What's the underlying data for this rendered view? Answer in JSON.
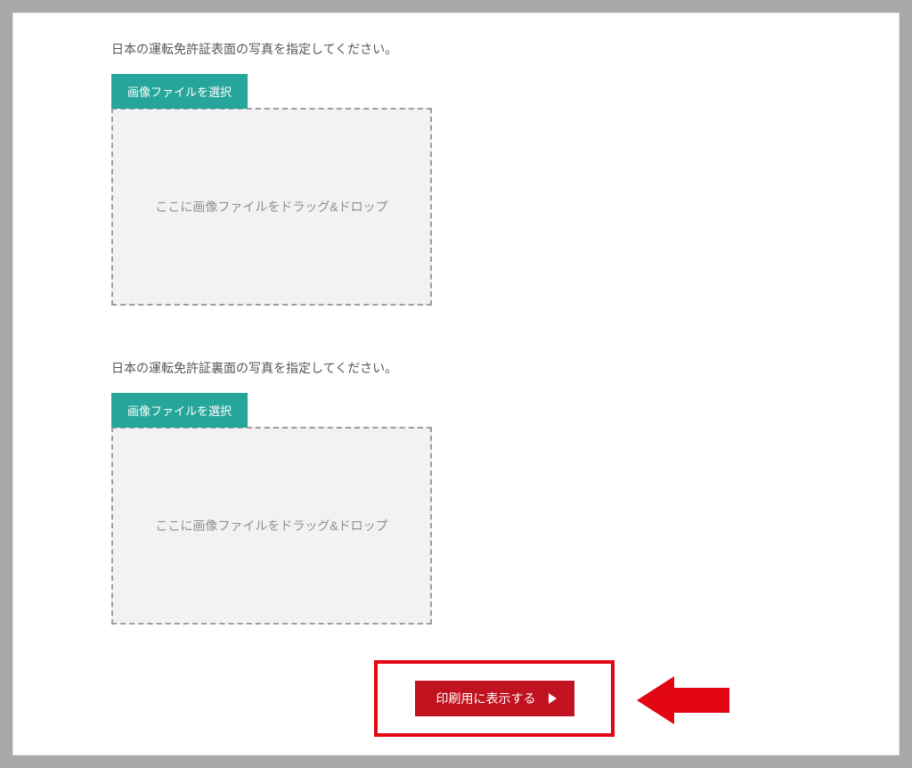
{
  "uploads": [
    {
      "instruction": "日本の運転免許証表面の写真を指定してください。",
      "select_label": "画像ファイルを選択",
      "dropzone_text": "ここに画像ファイルをドラッグ&ドロップ"
    },
    {
      "instruction": "日本の運転免許証裏面の写真を指定してください。",
      "select_label": "画像ファイルを選択",
      "dropzone_text": "ここに画像ファイルをドラッグ&ドロップ"
    }
  ],
  "action": {
    "print_label": "印刷用に表示する"
  }
}
